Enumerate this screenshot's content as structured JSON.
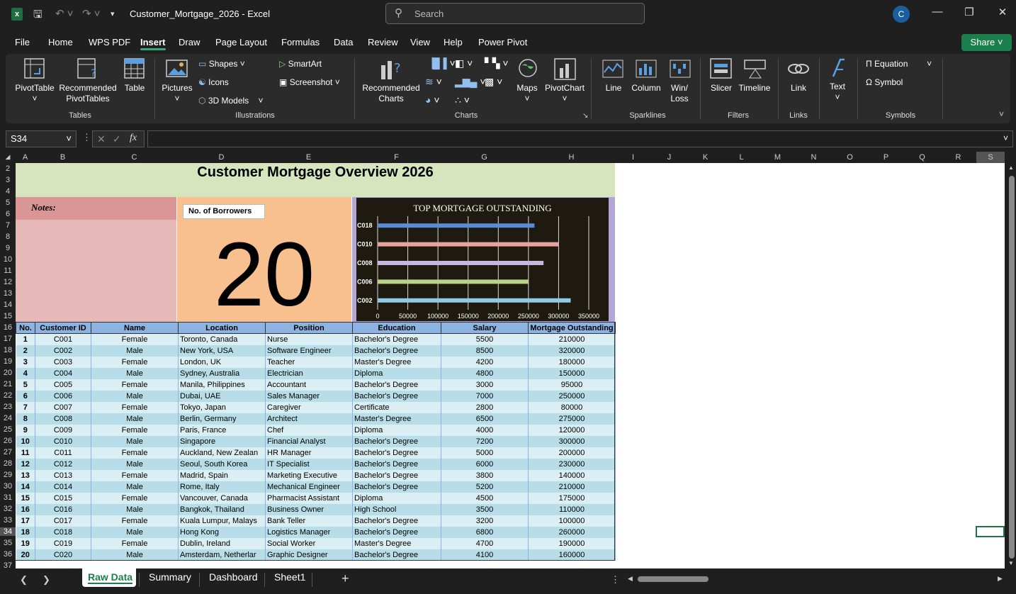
{
  "window": {
    "title": "Customer_Mortgage_2026  -  Excel",
    "search_placeholder": "Search",
    "user_initial": "C"
  },
  "menu": {
    "items": [
      "File",
      "Home",
      "WPS PDF",
      "Insert",
      "Draw",
      "Page Layout",
      "Formulas",
      "Data",
      "Review",
      "View",
      "Help",
      "Power Pivot"
    ],
    "active": "Insert",
    "share": "Share"
  },
  "ribbon": {
    "pivottable": "PivotTable",
    "rec_pivot": "Recommended PivotTables",
    "table": "Table",
    "pictures": "Pictures",
    "shapes": "Shapes",
    "icons": "Icons",
    "models": "3D Models",
    "smartart": "SmartArt",
    "screenshot": "Screenshot",
    "rec_charts": "Recommended Charts",
    "maps": "Maps",
    "pivotchart": "PivotChart",
    "line": "Line",
    "column": "Column",
    "winloss": "Win/ Loss",
    "slicer": "Slicer",
    "timeline": "Timeline",
    "link": "Link",
    "text": "Text",
    "equation": "Equation",
    "symbol": "Symbol",
    "groups": {
      "tables": "Tables",
      "illustrations": "Illustrations",
      "charts": "Charts",
      "sparklines": "Sparklines",
      "filters": "Filters",
      "links": "Links",
      "symbols": "Symbols"
    }
  },
  "formula_bar": {
    "namebox": "S34",
    "formula": ""
  },
  "columns": [
    "A",
    "B",
    "C",
    "D",
    "E",
    "F",
    "G",
    "H",
    "I",
    "J",
    "K",
    "L",
    "M",
    "N",
    "O",
    "P",
    "Q",
    "R",
    "S"
  ],
  "rows": [
    "2",
    "3",
    "4",
    "5",
    "6",
    "7",
    "8",
    "9",
    "10",
    "11",
    "12",
    "13",
    "14",
    "15",
    "16",
    "17",
    "18",
    "19",
    "20",
    "21",
    "22",
    "23",
    "24",
    "25",
    "26",
    "27",
    "28",
    "29",
    "30",
    "31",
    "32",
    "33",
    "34",
    "35",
    "36",
    "37"
  ],
  "dashboard": {
    "title": "Customer Mortgage Overview 2026",
    "notes_label": "Notes:",
    "kpi_label": "No. of Borrowers",
    "kpi_value": "20"
  },
  "chart_data": {
    "type": "bar",
    "title": "TOP MORTGAGE OUTSTANDING",
    "orientation": "horizontal",
    "categories": [
      "C018",
      "C010",
      "C008",
      "C006",
      "C002"
    ],
    "values": [
      260000,
      300000,
      275000,
      250000,
      320000
    ],
    "colors": [
      "#5b8bd6",
      "#e6a49f",
      "#c6b7df",
      "#b9d38a",
      "#93c9e6"
    ],
    "xlim": [
      0,
      350000
    ],
    "xticks": [
      "0",
      "50000",
      "100000",
      "150000",
      "200000",
      "250000",
      "300000",
      "350000"
    ],
    "grid": true
  },
  "table": {
    "headers": [
      "No.",
      "Customer ID",
      "Name",
      "Location",
      "Position",
      "Education",
      "Salary",
      "Mortgage Outstanding"
    ],
    "rows": [
      [
        "1",
        "C001",
        "Female",
        "Toronto, Canada",
        "Nurse",
        "Bachelor's Degree",
        "5500",
        "210000"
      ],
      [
        "2",
        "C002",
        "Male",
        "New York, USA",
        "Software Engineer",
        "Bachelor's Degree",
        "8500",
        "320000"
      ],
      [
        "3",
        "C003",
        "Female",
        "London, UK",
        "Teacher",
        "Master's Degree",
        "4200",
        "180000"
      ],
      [
        "4",
        "C004",
        "Male",
        "Sydney, Australia",
        "Electrician",
        "Diploma",
        "4800",
        "150000"
      ],
      [
        "5",
        "C005",
        "Female",
        "Manila, Philippines",
        "Accountant",
        "Bachelor's Degree",
        "3000",
        "95000"
      ],
      [
        "6",
        "C006",
        "Male",
        "Dubai, UAE",
        "Sales Manager",
        "Bachelor's Degree",
        "7000",
        "250000"
      ],
      [
        "7",
        "C007",
        "Female",
        "Tokyo, Japan",
        "Caregiver",
        "Certificate",
        "2800",
        "80000"
      ],
      [
        "8",
        "C008",
        "Male",
        "Berlin, Germany",
        "Architect",
        "Master's Degree",
        "6500",
        "275000"
      ],
      [
        "9",
        "C009",
        "Female",
        "Paris, France",
        "Chef",
        "Diploma",
        "4000",
        "120000"
      ],
      [
        "10",
        "C010",
        "Male",
        "Singapore",
        "Financial Analyst",
        "Bachelor's Degree",
        "7200",
        "300000"
      ],
      [
        "11",
        "C011",
        "Female",
        "Auckland, New Zealan",
        "HR Manager",
        "Bachelor's Degree",
        "5000",
        "200000"
      ],
      [
        "12",
        "C012",
        "Male",
        "Seoul, South Korea",
        "IT Specialist",
        "Bachelor's Degree",
        "6000",
        "230000"
      ],
      [
        "13",
        "C013",
        "Female",
        "Madrid, Spain",
        "Marketing Executive",
        "Bachelor's Degree",
        "3800",
        "140000"
      ],
      [
        "14",
        "C014",
        "Male",
        "Rome, Italy",
        "Mechanical Engineer",
        "Bachelor's Degree",
        "5200",
        "210000"
      ],
      [
        "15",
        "C015",
        "Female",
        "Vancouver, Canada",
        "Pharmacist Assistant",
        "Diploma",
        "4500",
        "175000"
      ],
      [
        "16",
        "C016",
        "Male",
        "Bangkok, Thailand",
        "Business Owner",
        "High School",
        "3500",
        "110000"
      ],
      [
        "17",
        "C017",
        "Female",
        "Kuala Lumpur, Malays",
        "Bank Teller",
        "Bachelor's Degree",
        "3200",
        "100000"
      ],
      [
        "18",
        "C018",
        "Male",
        "Hong Kong",
        "Logistics Manager",
        "Bachelor's Degree",
        "6800",
        "260000"
      ],
      [
        "19",
        "C019",
        "Female",
        "Dublin, Ireland",
        "Social Worker",
        "Master's Degree",
        "4700",
        "190000"
      ],
      [
        "20",
        "C020",
        "Male",
        "Amsterdam, Netherlar",
        "Graphic Designer",
        "Bachelor's Degree",
        "4100",
        "160000"
      ]
    ]
  },
  "sheet_tabs": {
    "items": [
      "Raw Data",
      "Summary",
      "Dashboard",
      "Sheet1"
    ],
    "active": "Raw Data"
  }
}
